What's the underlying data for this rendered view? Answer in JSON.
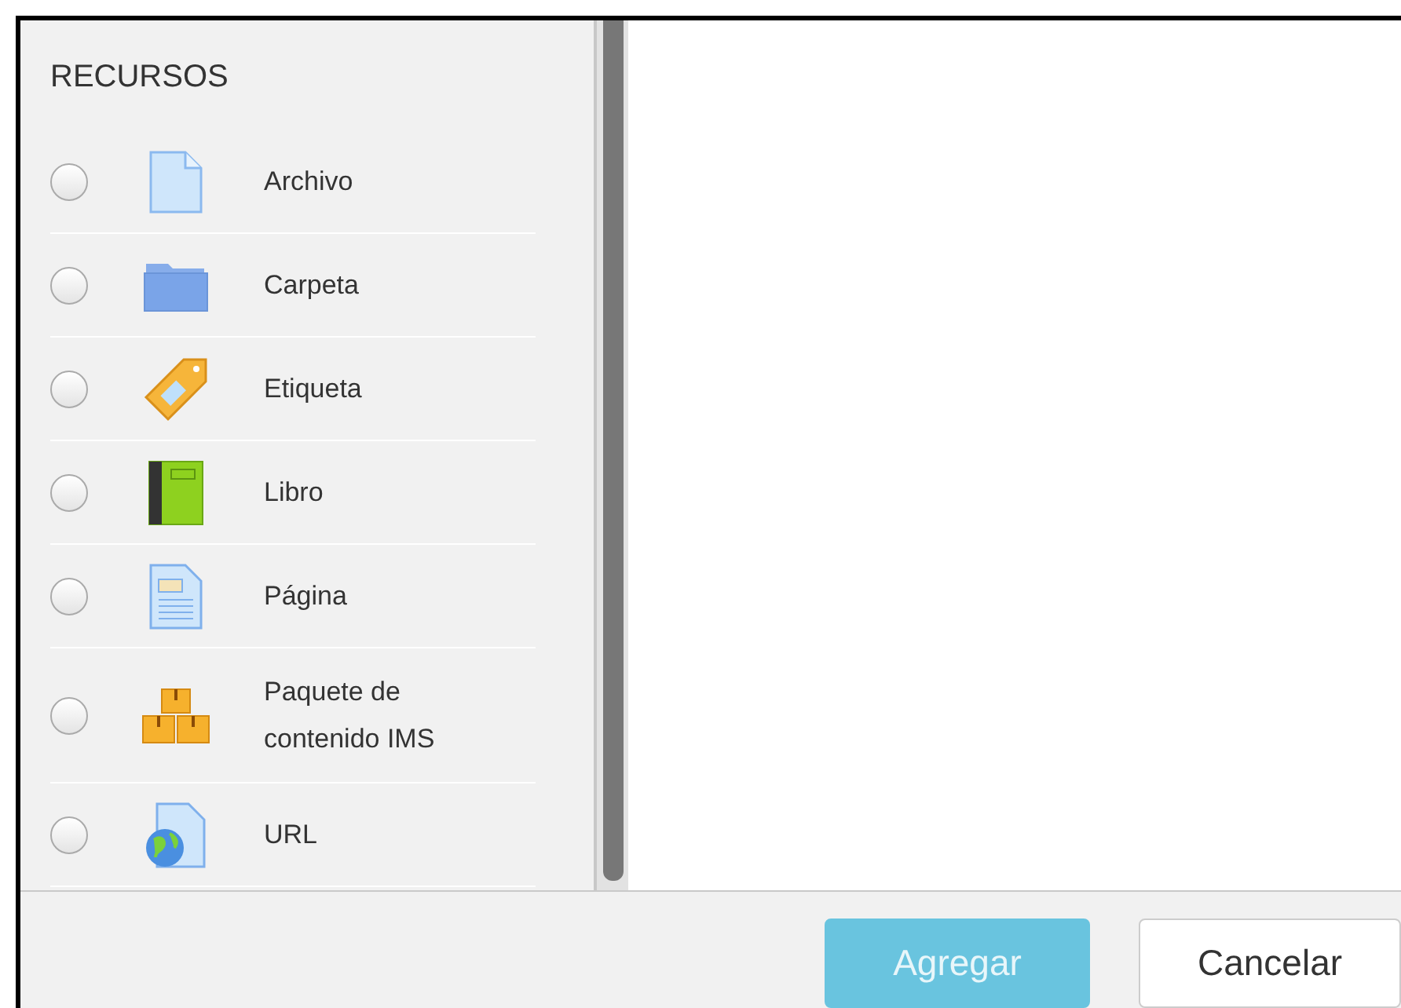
{
  "panel": {
    "title": "RECURSOS",
    "items": [
      {
        "kind": "file",
        "label": "Archivo",
        "selected": false
      },
      {
        "kind": "folder",
        "label": "Carpeta",
        "selected": false
      },
      {
        "kind": "tag",
        "label": "Etiqueta",
        "selected": false
      },
      {
        "kind": "book",
        "label": "Libro",
        "selected": false
      },
      {
        "kind": "page",
        "label": "Página",
        "selected": false
      },
      {
        "kind": "package",
        "label": "Paquete de contenido IMS",
        "selected": false
      },
      {
        "kind": "url",
        "label": "URL",
        "selected": false
      }
    ]
  },
  "buttons": [
    {
      "kind": "primary",
      "label": "Agregar",
      "disabled": true
    },
    {
      "kind": "secondary",
      "label": "Cancelar",
      "disabled": false
    }
  ]
}
